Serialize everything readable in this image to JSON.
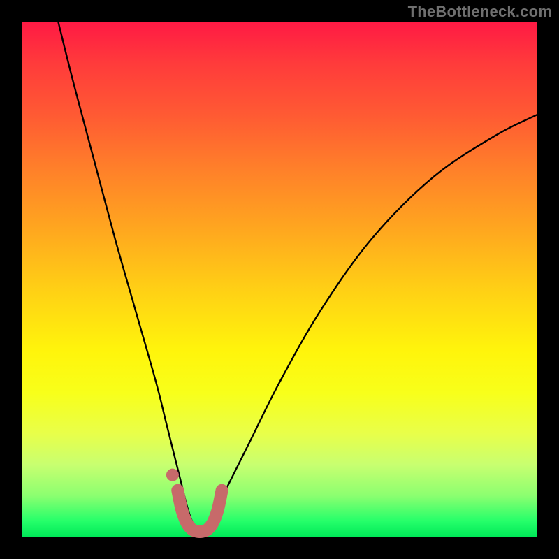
{
  "watermark": "TheBottleneck.com",
  "chart_data": {
    "type": "line",
    "title": "",
    "xlabel": "",
    "ylabel": "",
    "xlim": [
      0,
      100
    ],
    "ylim": [
      0,
      100
    ],
    "grid": false,
    "legend": false,
    "series": [
      {
        "name": "bottleneck-curve",
        "x": [
          7,
          10,
          14,
          18,
          22,
          26,
          28,
          30,
          31,
          32,
          33,
          34,
          35,
          36,
          37,
          38,
          40,
          44,
          50,
          58,
          68,
          80,
          92,
          100
        ],
        "values": [
          100,
          88,
          73,
          58,
          44,
          30,
          22,
          14,
          10,
          6,
          3,
          1.5,
          1,
          1.5,
          3,
          6,
          10,
          18,
          30,
          44,
          58,
          70,
          78,
          82
        ]
      }
    ],
    "annotations": [
      {
        "name": "valley-marker",
        "type": "thick-path",
        "color": "#c76a6a",
        "points_x": [
          30.2,
          31.0,
          32.0,
          33.0,
          34.0,
          35.0,
          36.0,
          37.0,
          38.0,
          38.8
        ],
        "points_y": [
          9.0,
          5.2,
          2.6,
          1.4,
          1.0,
          1.0,
          1.4,
          2.6,
          5.2,
          9.0
        ]
      },
      {
        "name": "valley-dot",
        "type": "dot",
        "color": "#c76a6a",
        "x": 29.2,
        "y": 12.0
      }
    ]
  }
}
